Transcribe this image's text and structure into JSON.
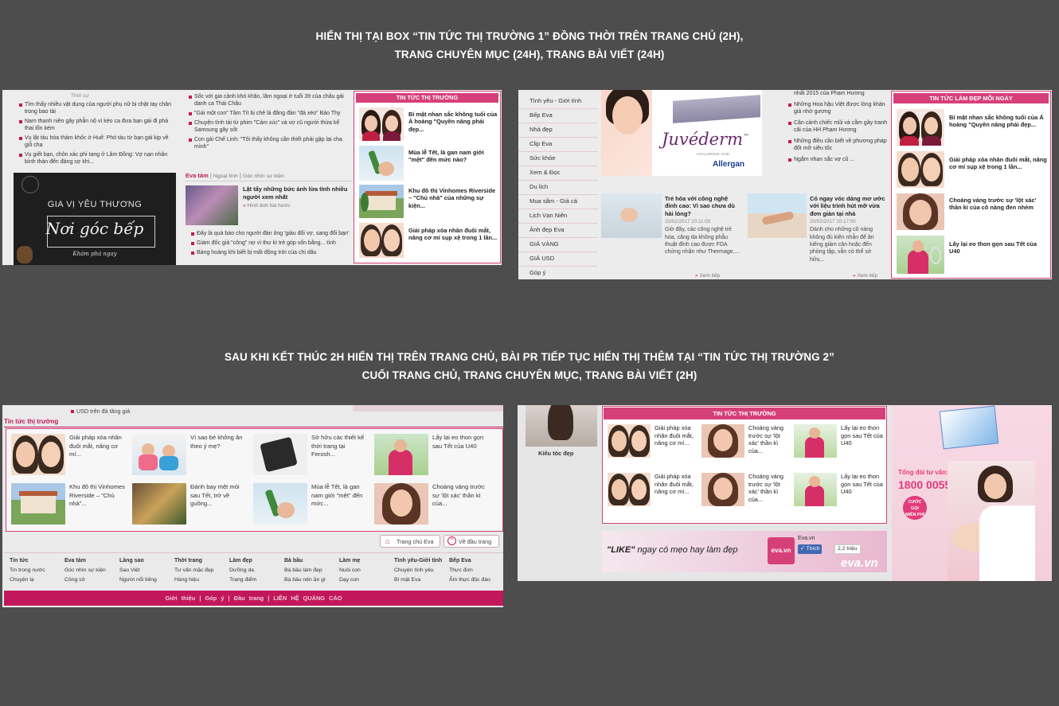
{
  "headings": {
    "top": [
      "HIỂN THỊ TẠI BOX “TIN TỨC THỊ TRƯỜNG 1” ĐỒNG THỜI TRÊN TRANG CHỦ (2H),",
      "TRANG CHUYÊN MỤC (24H), TRANG BÀI VIẾT (24H)"
    ],
    "middle": [
      "SAU KHI KẾT THÚC 2H HIỂN THỊ TRÊN TRANG CHỦ, BÀI PR TIẾP TỤC HIỂN THỊ THÊM TẠI “TIN TỨC THỊ TRƯỜNG 2”",
      "CUỐI TRANG CHỦ, TRANG CHUYÊN MỤC, TRANG BÀI VIẾT (2H)"
    ]
  },
  "shot1": {
    "thoi_su": "Thời sự",
    "left_news": [
      "Tìm thấy nhiều vật dụng của người phụ nữ bị chặt tay chân trong bao tải",
      "Nam thanh niên gây phẫn nộ vì kéo ca đưa bạn gái đi phá thai lốn kém",
      "Vụ lật tàu hỏa thảm khốc ở Huế: Phó tàu từ bạn gái kịp về giỗ cha",
      "Vụ giết bạn, chôn xác phi tang ở Lâm Đồng: Vợ nạn nhân bình thản đến đáng sợ khi..."
    ],
    "banner_title": "GIA VỊ YÊU THƯƠNG",
    "banner_script": "Nơi góc bếp",
    "banner_sub": "Khám phá ngay",
    "mid_news": [
      "Sốc với gia cảnh khó khăn, lâm ngoại ở tuổi 39 của châu gái danh ca Thái Châu",
      "\"Gái một con\" Tâm Tít bị chê là đăng đàn \"đá xéo\" Bảo Thy",
      "Chuyện tình tài từ phim \"Cảm xúc\" và vợ cũ người thừa kế Samsung gây sốt",
      "Con gái Chế Linh: \"Tôi thấy không cần thiết phải gặp lại cha mình\""
    ],
    "eva_tam": "Eva tám",
    "ngoai_tinh": "Ngoại tình",
    "goc_nhin": "Góc nhìn sự kiện",
    "feature_title": "Lật tẩy những bức ảnh lừa tình nhiều người xem nhất",
    "feature_sub": "Hình ảnh hài hước",
    "bottom_news": [
      "Đây là quà báo cho người đàn ông 'giàu đổi vợ, sang đổi bạn'",
      "Giám đốc giả \"công\" nợ vì thư kí trẻ góp vốn bằng... tình",
      "Bàng hoàng khi biết bị mất động trời của chị dâu"
    ],
    "box_title": "TIN TỨC THỊ TRƯỜNG",
    "box_items": [
      "Bí mật nhan sắc không tuổi của Á hoàng \"Quyền năng phái đẹp...",
      "Mùa lễ Tết, là gan nam giới \"mệt\" đến mức nào?",
      "Khu đô thị Vinhomes Riverside – \"Chủ nhà\" của những sự kiện...",
      "Giải pháp xóa nhăn đuôi mắt, nâng cơ mí sụp xệ trong 1 lần..."
    ]
  },
  "shot2": {
    "nav": [
      "Tình yêu - Giới tính",
      "Bếp Eva",
      "Nhà đẹp",
      "Clip Eva",
      "Sức khỏe",
      "Xem & Đọc",
      "Du lịch",
      "Mua sắm - Giá cả",
      "Lịch Vạn Niên",
      "Ảnh đẹp Eva",
      "GIÁ VÀNG",
      "GIÁ USD",
      "Góp ý"
    ],
    "brand": "Juvéderm",
    "brand_tm": "™",
    "brand_sub": "HYALURONIC ACID",
    "maker": "Allergan",
    "right_news": [
      "nhất 2015 của Phạm Hương",
      "Những Hoa hậu Việt được lòng khán giả nhờ gương",
      "Cận cảnh chiếc mũi và cằm gây tranh cãi của HH Phạm Hương",
      "Những điều cần biết về phương pháp đốt mỡ siêu tốc",
      "Ngắm nhan sắc vợ cũ ..."
    ],
    "art1_title": "Trẻ hóa với công nghệ đỉnh cao: Vì sao chưa dù hài lòng?",
    "art1_date": "20/02/2017 10:11:00",
    "art1_body": "Giờ đây, các công nghệ trẻ hóa, căng da không phẫu thuật đỉnh cao được FDA chứng nhận như Thermage,...",
    "art2_title": "Có ngay vóc dáng mơ ước với liệu trình hút mỡ vừa đơn giản tại nhà",
    "art2_date": "20/02/2017 10:17:00",
    "art2_body": "Dành cho những cô nàng không đủ kiên nhẫn để ăn kiêng giảm cân hoặc đến phòng tập, vẫn có thể sở hữu...",
    "more": "Xem tiếp",
    "box_title": "TIN TỨC LÀM ĐẸP MỖI NGÀY",
    "box_items": [
      "Bí mật nhan sắc không tuổi của Á hoàng \"Quyền năng phái đẹp...",
      "Giải pháp xóa nhăn đuôi mắt, nâng cơ mí sụp xệ trong 1 lần...",
      "Choáng váng trước sự 'lột xác' thần kì của cô nàng đen nhẻm",
      "Lấy lại eo thon gọn sau Tết của U40"
    ]
  },
  "shot3": {
    "top_line": "USD trên đà tăng giá",
    "section_title": "Tin tức thị trường",
    "grid": [
      "Giải pháp xóa nhăn đuôi mắt, nâng cơ mí...",
      "Vì sao bé không ăn theo ý mẹ?",
      "Sở hữu các thiết kế thời trang tại Ferosh...",
      "Lấy lại eo thon gọn sau Tết của U40",
      "Khu đô thị Vinhomes Riverside – \"Chủ nhà\"...",
      "Đánh bay mệt mỏi sau Tết, trở về guồng...",
      "Mùa lễ Tết, là gan nam giới \"mệt\" đến mức...",
      "Choáng váng trước sự 'lột xác' thần kì của..."
    ],
    "home_btn": "Trang chủ Eva",
    "top_btn": "Về đầu trang",
    "footer_cols": [
      {
        "h": "Tin tức",
        "a": "Tin trong nước",
        "b": "Chuyện lạ"
      },
      {
        "h": "Eva tám",
        "a": "Góc nhìn sự kiện",
        "b": "Công sở"
      },
      {
        "h": "Làng sao",
        "a": "Sao Việt",
        "b": "Người nổi tiếng"
      },
      {
        "h": "Thời trang",
        "a": "Tư vấn mặc đẹp",
        "b": "Hàng hiệu"
      },
      {
        "h": "Làm đẹp",
        "a": "Dưỡng da",
        "b": "Trang điểm"
      },
      {
        "h": "Bà bầu",
        "a": "Bà bầu làm đẹp",
        "b": "Bà bầu nên ăn gì"
      },
      {
        "h": "Làm mẹ",
        "a": "Nuôi con",
        "b": "Dạy con"
      },
      {
        "h": "Tình yêu-Giới tính",
        "a": "Chuyện tình yêu",
        "b": "Bí mật Eva"
      },
      {
        "h": "Bếp Eva",
        "a": "Thực đơn",
        "b": "Ẩm thực độc đáo"
      }
    ],
    "footer_links": [
      "Giới thiệu",
      "|",
      "Góp ý",
      "|",
      "Đầu trang",
      "|",
      "LIÊN HỆ QUẢNG CÁO"
    ]
  },
  "shot4": {
    "side_label": "Kiểu tóc đẹp",
    "box_title": "TIN TỨC THỊ TRƯỜNG",
    "grid": [
      "Giải pháp xóa nhăn đuôi mắt, nâng cơ mí...",
      "Choáng váng trước sự 'lột xác' thần kì của...",
      "Lấy lại eo thon gọn sau Tết của U40",
      "Giải pháp xóa nhăn đuôi mắt, nâng cơ mí...",
      "Choáng váng trước sự 'lột xác' thần kì của...",
      "Lấy lại eo thon gọn sau Tết của U40"
    ],
    "like_text_q": "\"LIKE\"",
    "like_text": " ngay có mẹo hay làm đẹp",
    "fb_name": "Eva.vn",
    "fb_btn": "Thích",
    "fb_count": "2,2 triệu",
    "eva_logo": "eva.vn",
    "ad_line1": "Tổng đài tư vấn:",
    "ad_phone": "1800 0055",
    "ad_badge_1": "CƯỚC",
    "ad_badge_2": "GỌI",
    "ad_badge_3": "MIỄN PHÍ"
  }
}
